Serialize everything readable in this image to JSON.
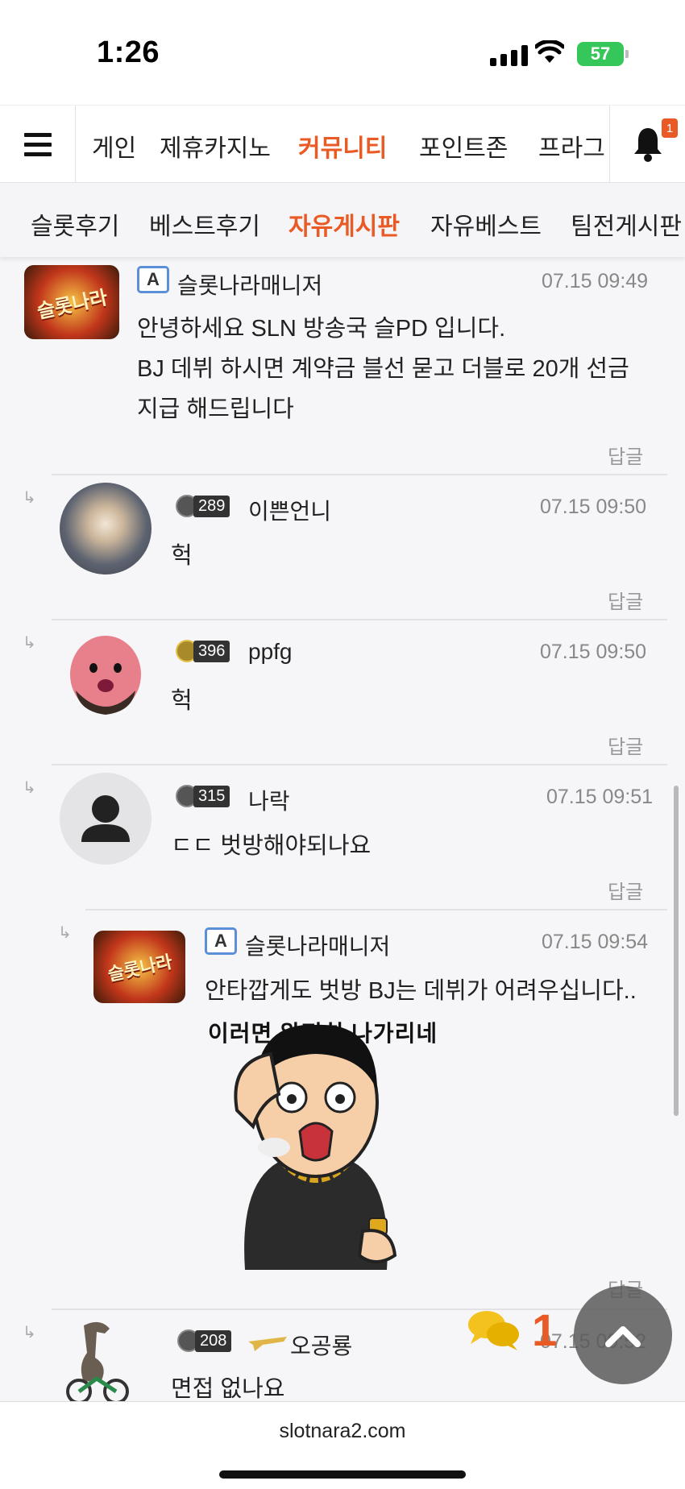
{
  "status_bar": {
    "time": "1:26",
    "battery": "57"
  },
  "main_nav": {
    "items": [
      "게인",
      "제휴카지노",
      "커뮤니티",
      "포인트존",
      "프라그"
    ],
    "active": "커뮤니티",
    "notification_count": "1"
  },
  "sub_nav": {
    "items": [
      "슬롯후기",
      "베스트후기",
      "자유게시판",
      "자유베스트",
      "팀전게시판"
    ],
    "active": "자유게시판"
  },
  "comments": [
    {
      "nickname": "슬롯나라매니저",
      "badge": "A",
      "time": "07.15 09:49",
      "lines": [
        "안녕하세요 SLN 방송국 슬PD 입니다.",
        "BJ 데뷔 하시면 계약금 블선 묻고 더블로 20개 선금",
        "지급 해드립니다"
      ],
      "reply_label": "답글",
      "avatar_text": "슬롯나라"
    },
    {
      "nickname": "이쁜언니",
      "level": "289",
      "time": "07.15 09:50",
      "text": "헉",
      "reply_label": "답글"
    },
    {
      "nickname": "ppfg",
      "level": "396",
      "time": "07.15 09:50",
      "text": "헉",
      "reply_label": "답글"
    },
    {
      "nickname": "나락",
      "level": "315",
      "time": "07.15 09:51",
      "text": "ㄷㄷ 벗방해야되나요",
      "reply_label": "답글"
    },
    {
      "nickname": "슬롯나라매니저",
      "badge": "A",
      "time": "07.15 09:54",
      "text": "안타깝게도 벗방 BJ는 데뷔가 어려우십니다..",
      "sticker_caption": "이러면 완전히 나가리네",
      "reply_label": "답글",
      "avatar_text": "슬롯나라"
    },
    {
      "nickname": "오공룡",
      "level": "208",
      "time": "07.15 09:52",
      "text": "면접 없나요"
    }
  ],
  "floating": {
    "chat_count": "1"
  },
  "footer": {
    "url": "slotnara2.com"
  },
  "colors": {
    "accent": "#ea5a25",
    "background": "#f6f6f8"
  }
}
